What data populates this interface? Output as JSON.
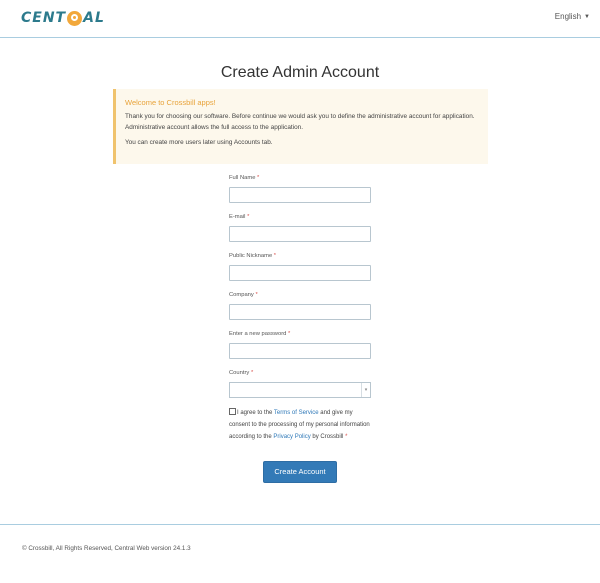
{
  "header": {
    "logo_part1": "CENT",
    "logo_part2": "AL",
    "language": "English",
    "caret_icon": "caret-down-icon"
  },
  "page_title": "Create Admin Account",
  "alert": {
    "title": "Welcome to Crossbill apps!",
    "line1": "Thank you for choosing our software. Before continue we would ask you to define the administrative account for application. Administrative account allows the full access to the application.",
    "line2": "You can create more users later using Accounts tab."
  },
  "form": {
    "full_name": {
      "label": "Full Name",
      "required": "*",
      "value": ""
    },
    "email": {
      "label": "E-mail",
      "required": "*",
      "value": ""
    },
    "nickname": {
      "label": "Public Nickname",
      "required": "*",
      "value": ""
    },
    "company": {
      "label": "Company",
      "required": "*",
      "value": ""
    },
    "password": {
      "label": "Enter a new password",
      "required": "*",
      "value": ""
    },
    "country": {
      "label": "Country",
      "required": "*",
      "value": ""
    },
    "agree": {
      "text1": "I agree to the ",
      "terms_link": "Terms of Service",
      "text2": " and give my consent to the processing of my personal information according to the ",
      "privacy_link": "Privacy Policy",
      "text3": " by Crossbill",
      "required": "*"
    },
    "submit_label": "Create Account"
  },
  "footer": {
    "text": "© Crossbill, All Rights Reserved, Central Web version 24.1.3"
  }
}
